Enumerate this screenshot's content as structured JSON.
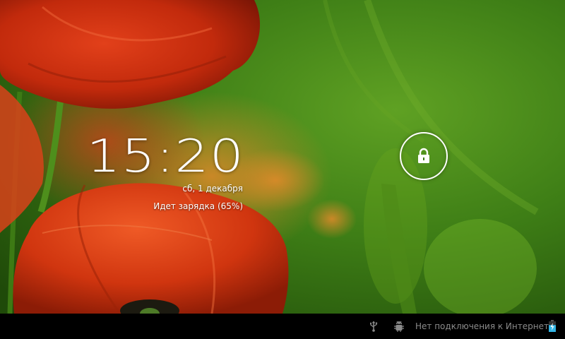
{
  "lockscreen": {
    "time": "15:20",
    "date": "сб, 1 декабря",
    "charging_status": "Идет зарядка (65%)",
    "unlock_icon": "padlock-icon"
  },
  "status_bar": {
    "network_status": "Нет подключения к Интернету",
    "battery_level": 0.65,
    "icons": [
      "usb-icon",
      "usb-debugging-icon",
      "battery-charging-icon"
    ]
  },
  "colors": {
    "status_bar_background": "#000000",
    "status_text": "#8a8a8a",
    "battery_accent": "#33b5e5",
    "clock_text": "#ffffff"
  }
}
